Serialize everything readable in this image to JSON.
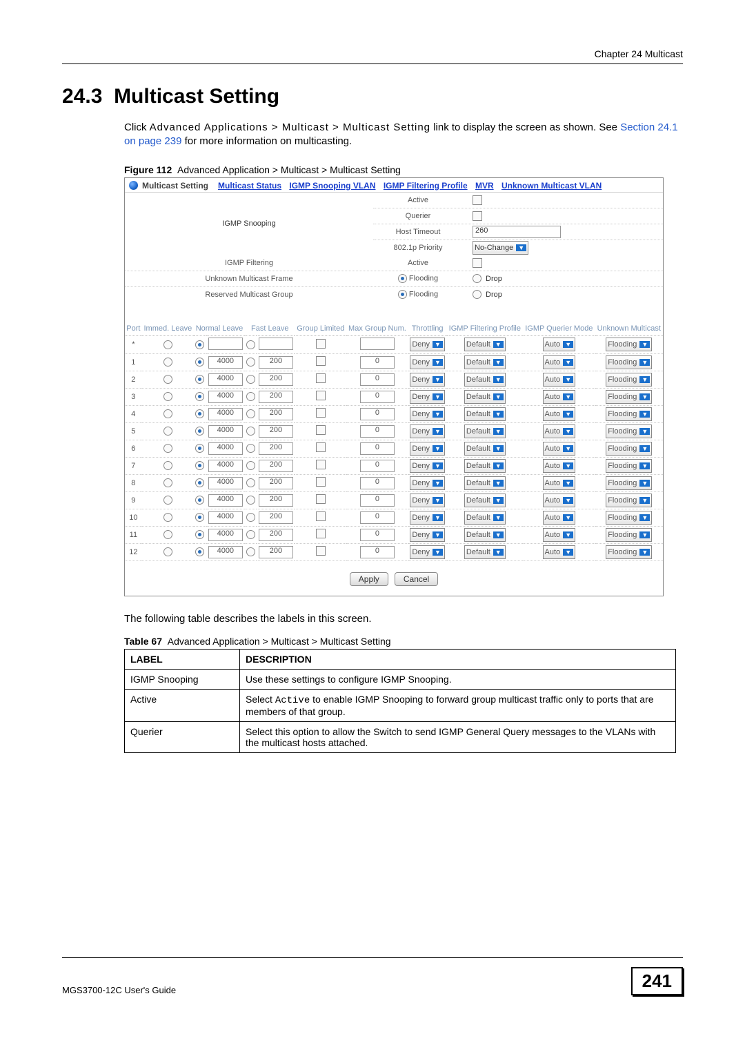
{
  "chapter_header": "Chapter 24 Multicast",
  "section_number": "24.3",
  "section_title": "Multicast Setting",
  "intro_1": "Click ",
  "intro_breadcrumb": "Advanced Applications > Multicast > Multicast Setting",
  "intro_2": " link to display the screen as shown. See ",
  "intro_link": "Section 24.1 on page 239",
  "intro_3": " for more information on multicasting.",
  "figure_label": "Figure 112",
  "figure_caption": "Advanced Application > Multicast > Multicast Setting",
  "screenshot": {
    "tab_name": "Multicast Setting",
    "nav_links": [
      "Multicast Status",
      "IGMP Snooping VLAN",
      "IGMP Filtering Profile",
      "MVR",
      "Unknown Multicast VLAN"
    ],
    "igmp_snooping_label": "IGMP Snooping",
    "rows_top": [
      {
        "mid": "Active",
        "ctrl": "checkbox"
      },
      {
        "mid": "Querier",
        "ctrl": "checkbox"
      },
      {
        "mid": "Host Timeout",
        "ctrl": "text",
        "value": "260"
      },
      {
        "mid": "802.1p Priority",
        "ctrl": "select",
        "value": "No-Change"
      }
    ],
    "igmp_filtering_label": "IGMP Filtering",
    "igmp_filtering_mid": "Active",
    "umf_label": "Unknown Multicast Frame",
    "rmg_label": "Reserved Multicast Group",
    "flooding": "Flooding",
    "drop": "Drop",
    "port_headers": [
      "Port",
      "Immed. Leave",
      "Normal Leave",
      "Fast Leave",
      "Group Limited",
      "Max Group Num.",
      "Throttling",
      "IGMP Filtering Profile",
      "IGMP Querier Mode",
      "Unknown Multicast"
    ],
    "port_rows": [
      {
        "port": "*",
        "normal": "",
        "fast": "",
        "max": "",
        "thr": "Deny",
        "prof": "Default",
        "mode": "Auto",
        "um": "Flooding"
      },
      {
        "port": "1",
        "normal": "4000",
        "fast": "200",
        "max": "0",
        "thr": "Deny",
        "prof": "Default",
        "mode": "Auto",
        "um": "Flooding"
      },
      {
        "port": "2",
        "normal": "4000",
        "fast": "200",
        "max": "0",
        "thr": "Deny",
        "prof": "Default",
        "mode": "Auto",
        "um": "Flooding"
      },
      {
        "port": "3",
        "normal": "4000",
        "fast": "200",
        "max": "0",
        "thr": "Deny",
        "prof": "Default",
        "mode": "Auto",
        "um": "Flooding"
      },
      {
        "port": "4",
        "normal": "4000",
        "fast": "200",
        "max": "0",
        "thr": "Deny",
        "prof": "Default",
        "mode": "Auto",
        "um": "Flooding"
      },
      {
        "port": "5",
        "normal": "4000",
        "fast": "200",
        "max": "0",
        "thr": "Deny",
        "prof": "Default",
        "mode": "Auto",
        "um": "Flooding"
      },
      {
        "port": "6",
        "normal": "4000",
        "fast": "200",
        "max": "0",
        "thr": "Deny",
        "prof": "Default",
        "mode": "Auto",
        "um": "Flooding"
      },
      {
        "port": "7",
        "normal": "4000",
        "fast": "200",
        "max": "0",
        "thr": "Deny",
        "prof": "Default",
        "mode": "Auto",
        "um": "Flooding"
      },
      {
        "port": "8",
        "normal": "4000",
        "fast": "200",
        "max": "0",
        "thr": "Deny",
        "prof": "Default",
        "mode": "Auto",
        "um": "Flooding"
      },
      {
        "port": "9",
        "normal": "4000",
        "fast": "200",
        "max": "0",
        "thr": "Deny",
        "prof": "Default",
        "mode": "Auto",
        "um": "Flooding"
      },
      {
        "port": "10",
        "normal": "4000",
        "fast": "200",
        "max": "0",
        "thr": "Deny",
        "prof": "Default",
        "mode": "Auto",
        "um": "Flooding"
      },
      {
        "port": "11",
        "normal": "4000",
        "fast": "200",
        "max": "0",
        "thr": "Deny",
        "prof": "Default",
        "mode": "Auto",
        "um": "Flooding"
      },
      {
        "port": "12",
        "normal": "4000",
        "fast": "200",
        "max": "0",
        "thr": "Deny",
        "prof": "Default",
        "mode": "Auto",
        "um": "Flooding"
      }
    ],
    "apply": "Apply",
    "cancel": "Cancel"
  },
  "post_text": "The following table describes the labels in this screen.",
  "table_label": "Table 67",
  "table_caption": "Advanced Application > Multicast > Multicast Setting",
  "desc_table": {
    "head_label": "LABEL",
    "head_desc": "DESCRIPTION",
    "rows": [
      {
        "label": "IGMP Snooping",
        "desc": "Use these settings to configure IGMP Snooping."
      },
      {
        "label": "Active",
        "desc_pre": "Select ",
        "desc_code": "Active",
        "desc_post": " to enable IGMP Snooping to forward group multicast traffic only to ports that are members of that group."
      },
      {
        "label": "Querier",
        "desc": "Select this option to allow the Switch to send IGMP General Query messages to the VLANs with the multicast hosts attached."
      }
    ]
  },
  "footer_guide": "MGS3700-12C User's Guide",
  "page_number": "241"
}
